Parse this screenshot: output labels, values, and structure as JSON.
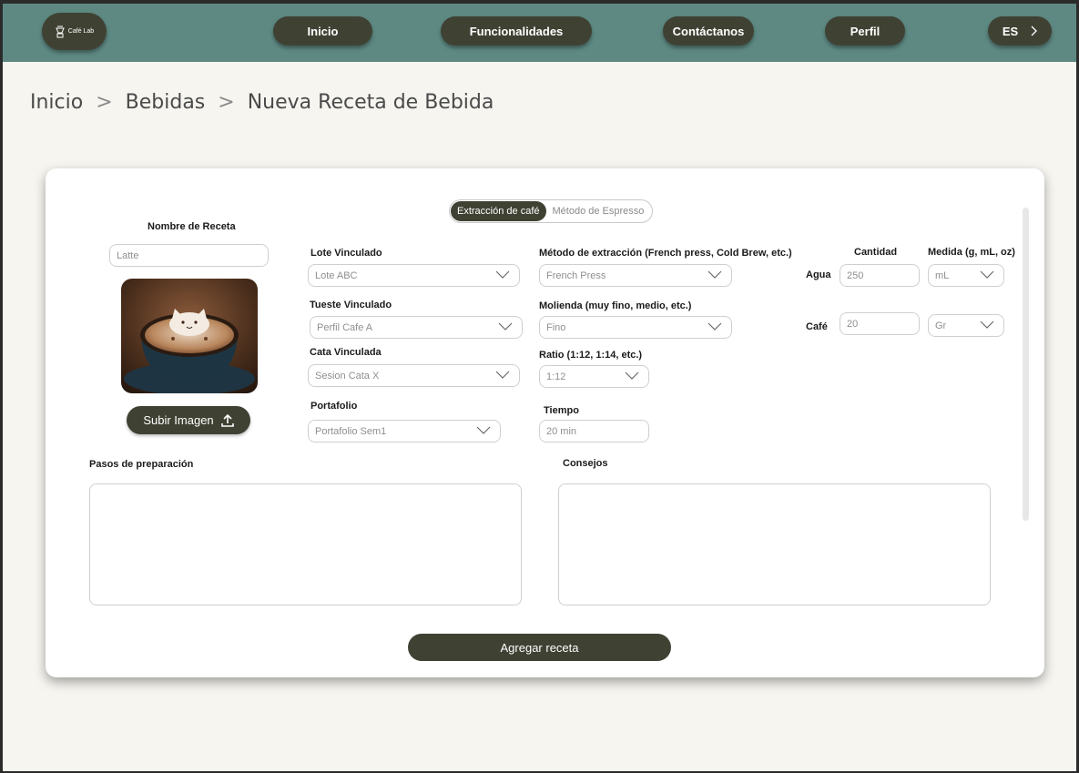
{
  "nav": {
    "logo_text": "Café Lab",
    "items": [
      {
        "label": "Inicio"
      },
      {
        "label": "Funcionalidades"
      },
      {
        "label": "Contáctanos"
      },
      {
        "label": "Perfil"
      }
    ],
    "language": "ES"
  },
  "breadcrumb": {
    "items": [
      "Inicio",
      "Bebidas",
      "Nueva Receta de Bebida"
    ],
    "separator": ">"
  },
  "form": {
    "mode_toggle": {
      "options": [
        "Extracción de café",
        "Método de Espresso"
      ],
      "selected": "Extracción de café"
    },
    "recipe_name": {
      "label": "Nombre de Receta",
      "value": "Latte"
    },
    "upload_label": "Subir Imagen",
    "lote": {
      "label": "Lote Vinculado",
      "value": "Lote ABC"
    },
    "tueste": {
      "label": "Tueste Vinculado",
      "value": "Perfil Cafe A"
    },
    "cata": {
      "label": "Cata Vinculada",
      "value": "Sesion Cata X"
    },
    "portafolio": {
      "label": "Portafolio",
      "value": "Portafolio Sem1"
    },
    "metodo": {
      "label": "Método de extracción (French press, Cold Brew, etc.)",
      "value": "French Press"
    },
    "molienda": {
      "label": "Molienda (muy fino, medio, etc.)",
      "value": "Fino"
    },
    "ratio": {
      "label": "Ratio (1:12, 1:14, etc.)",
      "value": "1:12"
    },
    "tiempo": {
      "label": "Tiempo",
      "value": "20 min"
    },
    "cantidad_header": "Cantidad",
    "medida_header": "Medida (g, mL, oz)",
    "agua": {
      "label": "Agua",
      "cantidad": "250",
      "medida": "mL"
    },
    "cafe": {
      "label": "Café",
      "cantidad": "20",
      "medida": "Gr"
    },
    "pasos": {
      "label": "Pasos de preparación",
      "value": ""
    },
    "consejos": {
      "label": "Consejos",
      "value": ""
    },
    "submit_label": "Agregar receta"
  },
  "colors": {
    "topbar": "#5e8983",
    "primary": "#3f4233",
    "page_bg": "#f6f5f0"
  }
}
